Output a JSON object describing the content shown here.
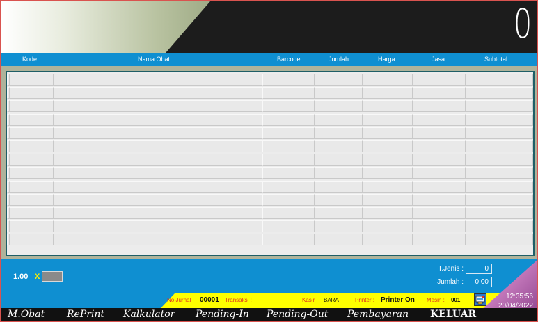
{
  "display": {
    "total": "0"
  },
  "columns": [
    "Kode",
    "Nama Obat",
    "Barcode",
    "Jumlah",
    "Harga",
    "Jasa",
    "Subtotal"
  ],
  "table": {
    "visible_rows": 13
  },
  "quantity": {
    "value": "1.00",
    "multiplier": "X"
  },
  "summary": {
    "t_jenis_label": "T.Jenis :",
    "t_jenis_value": "0",
    "jumlah_label": "Jumlah :",
    "jumlah_value": "0.00"
  },
  "status": {
    "no_jurnal_label": "No.Jurnal :",
    "no_jurnal_value": "00001",
    "transaksi_label": "Transaksi :",
    "transaksi_value": "",
    "kasir_label": "Kasir :",
    "kasir_value": "BARA",
    "printer_label": "Printer :",
    "printer_value": "Printer On",
    "mesin_label": "Mesin :",
    "mesin_value": "001"
  },
  "nav": {
    "m_obat": "M.Obat",
    "reprint": "RePrint",
    "kalkulator": "Kalkulator",
    "pending_in": "Pending-In",
    "pending_out": "Pending-Out",
    "pembayaran": "Pembayaran",
    "keluar": "KELUAR"
  },
  "clock": {
    "time": "12:35:56",
    "date": "20/04/2022"
  },
  "colors": {
    "header_blue": "#0f8fd1",
    "banner_dark": "#1c1c1c",
    "status_yellow": "#ffff00",
    "status_label_red": "#e0321e"
  }
}
